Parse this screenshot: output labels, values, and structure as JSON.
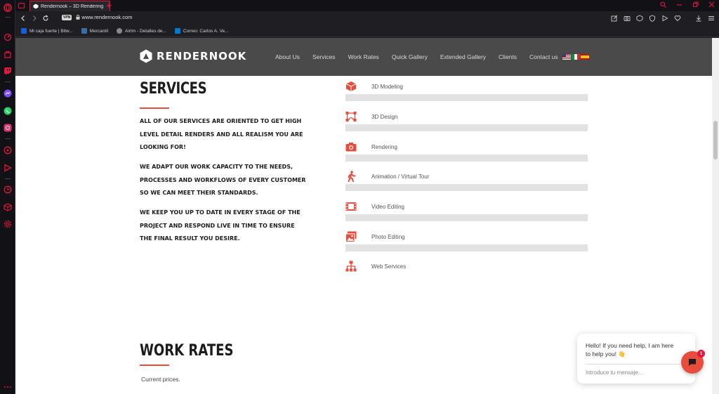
{
  "browser": {
    "tab_title": "Rendernook – 3D Rendering",
    "url": "www.rendernook.com",
    "vpn_label": "VPN",
    "bookmarks": [
      {
        "label": "Mi caja fuerte | Bitw...",
        "color": "#175ddc"
      },
      {
        "label": "Mercantil",
        "color": "#3a6ea5"
      },
      {
        "label": "Airtm - Detalles de...",
        "color": "#888888"
      },
      {
        "label": "Correo: Carlos A. Ve...",
        "color": "#0078d4"
      }
    ],
    "accent": "#e3163d"
  },
  "site": {
    "logo_text": "RENDERNOOK",
    "nav": [
      "About Us",
      "Services",
      "Work Rates",
      "Quick Gallery",
      "Extended Gallery",
      "Clients",
      "Contact us"
    ],
    "accent": "#e74c3c"
  },
  "services": {
    "title": "SERVICES",
    "paragraphs": [
      "All of our services are oriented to get high level detail renders and all realism you are looking for!",
      "We adapt our work capacity to the needs, processes and workflows of every customer so we can meet their standards.",
      "We keep you up to date in every stage of the project and respond live in time to ensure the final result you desire."
    ],
    "items": [
      {
        "label": "3D Modeling",
        "icon": "cube-icon"
      },
      {
        "label": "3D Design",
        "icon": "vector-nodes-icon"
      },
      {
        "label": "Rendering",
        "icon": "camera-icon"
      },
      {
        "label": "Animation / Virtual Tour",
        "icon": "walking-person-icon"
      },
      {
        "label": "Video Editing",
        "icon": "film-icon"
      },
      {
        "label": "Photo Editing",
        "icon": "photo-icon"
      },
      {
        "label": "Web Services",
        "icon": "sitemap-icon"
      }
    ]
  },
  "work_rates": {
    "title": "WORK RATES",
    "subtitle": "Current prices."
  },
  "chat": {
    "message": "Hello! If you need help, I am here to help you! 👋",
    "placeholder": "Introduce tu mensaje...",
    "badge": "1"
  }
}
